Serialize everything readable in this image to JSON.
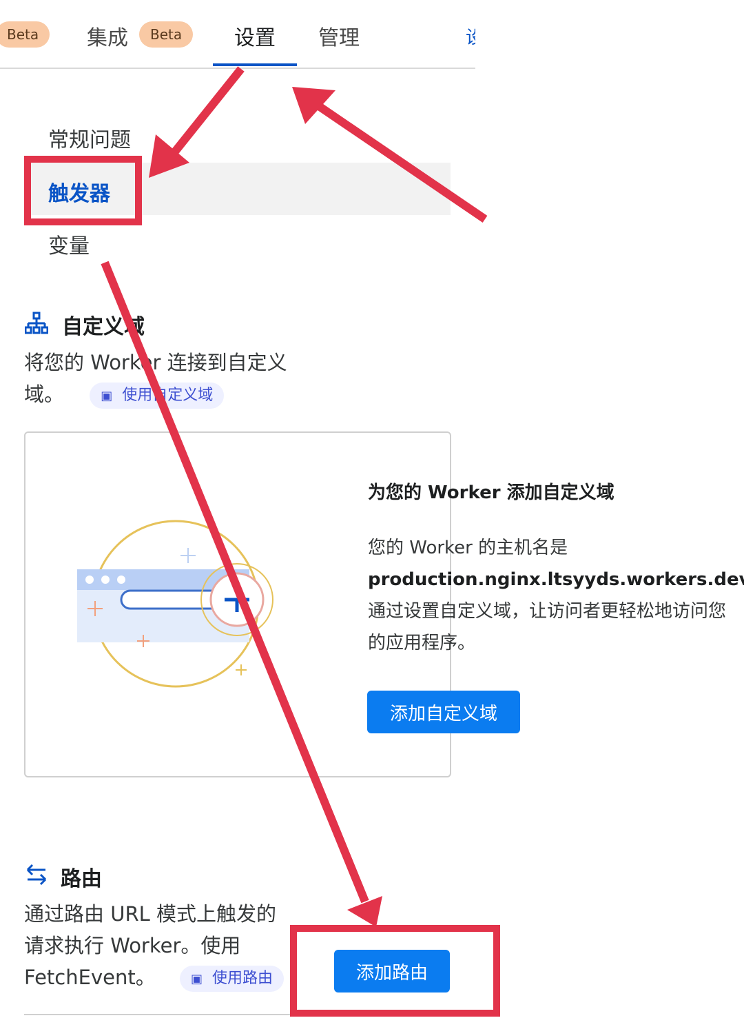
{
  "tabs": {
    "partial_badge": "Beta",
    "integrations_label": "集成",
    "integrations_badge": "Beta",
    "settings_label": "设置",
    "manage_label": "管理",
    "cut_label": "设"
  },
  "menu": {
    "general": "常规问题",
    "triggers": "触发器",
    "variables": "变量"
  },
  "custom_domain": {
    "title": "自定义域",
    "desc_line1": "将您的 Worker 连接到自定义",
    "desc_line2": "域。",
    "doc_link": "使用自定义域",
    "card_title": "为您的 Worker 添加自定义域",
    "card_text_1": "您的 Worker 的主机名是",
    "card_hostname": "production.nginx.ltsyyds.workers.dev",
    "card_text_2": "。通过设置自定义域，让访问者更轻松地访问您的应用程序。",
    "add_button": "添加自定义域"
  },
  "routes": {
    "title": "路由",
    "desc_line1": "通过路由 URL 模式上触发的",
    "desc_line2": "请求执行 Worker。使用",
    "desc_line3": "FetchEvent。",
    "doc_link": "使用路由",
    "add_button": "添加路由"
  },
  "colors": {
    "accent": "#0a54c6",
    "button": "#0b7cf0",
    "annotation": "#e2334a",
    "badge": "#f9c9a4"
  },
  "icons": {
    "custom_domain": "sitemap-icon",
    "routes": "swap-arrows-icon",
    "doc": "book-icon"
  }
}
